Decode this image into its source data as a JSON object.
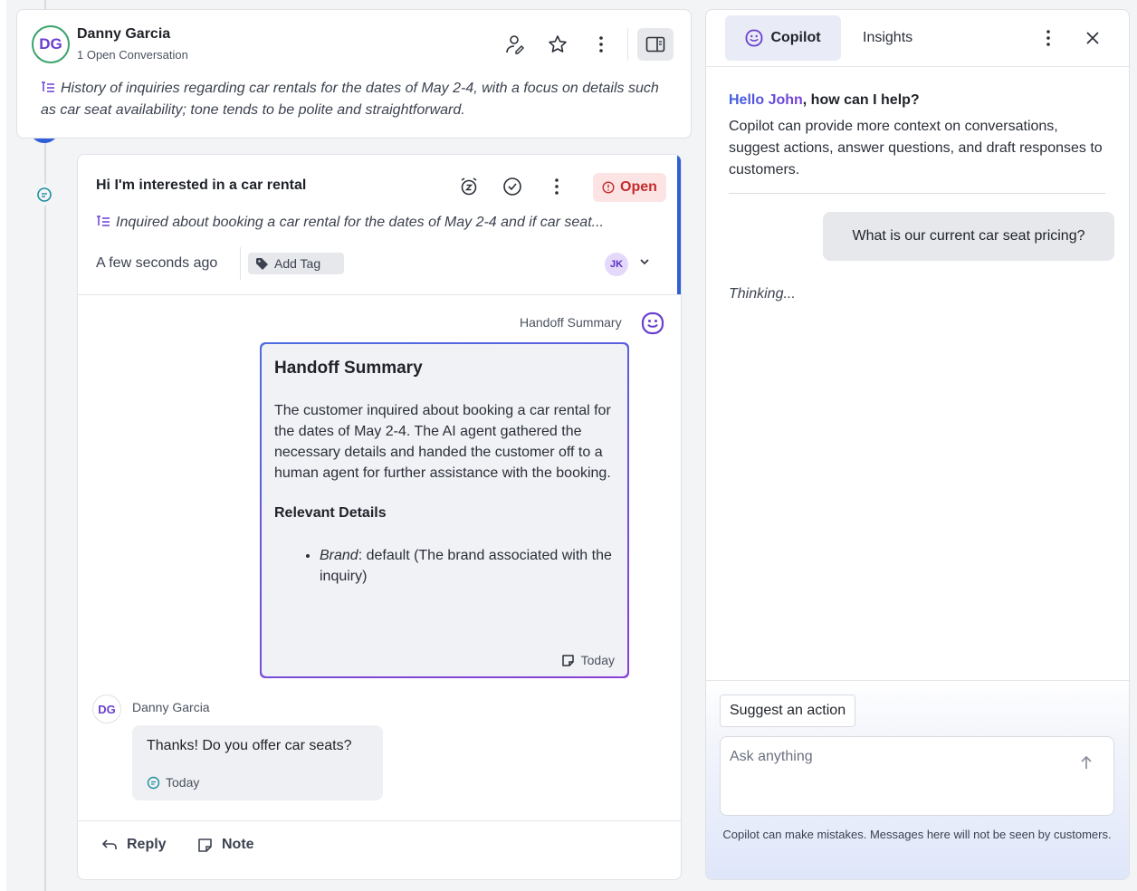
{
  "contact": {
    "initials": "DG",
    "name": "Danny Garcia",
    "subtitle": "1 Open Conversation",
    "summary": "History of inquiries regarding car rentals for the dates of May 2-4, with a focus on details such as car seat availability; tone tends to be polite and straightforward."
  },
  "conversation": {
    "title": "Hi I'm interested in a car rental",
    "status": "Open",
    "summary": "Inquired about booking a car rental for the dates of May 2-4 and if car seat...",
    "time": "A few seconds ago",
    "add_tag_label": "Add Tag",
    "assignee_initials": "JK",
    "status_color": "#c42b2b"
  },
  "handoff": {
    "label": "Handoff Summary",
    "title": "Handoff Summary",
    "body": "The customer inquired about booking a car rental for the dates of May 2-4. The AI agent gathered the necessary details and handed the customer off to a human agent for further assistance with the booking.",
    "details_title": "Relevant Details",
    "detail_key": "Brand",
    "detail_value": ": default (The brand associated with the inquiry)",
    "date": "Today"
  },
  "message": {
    "author_initials": "DG",
    "author": "Danny Garcia",
    "text": "Thanks! Do you offer car seats?",
    "date": "Today"
  },
  "composer": {
    "reply_label": "Reply",
    "note_label": "Note"
  },
  "copilot": {
    "tabs": [
      {
        "label": "Copilot",
        "active": true
      },
      {
        "label": "Insights",
        "active": false
      }
    ],
    "greeting_name": "Hello John",
    "greeting_rest": ", how can I help?",
    "intro": "Copilot can provide more context on conversations, suggest actions, answer questions, and draft responses to customers.",
    "user_question": "What is our current car seat pricing?",
    "thinking": "Thinking...",
    "suggest_label": "Suggest an action",
    "ask_placeholder": "Ask anything",
    "disclaimer": "Copilot can make mistakes. Messages here will not be seen by customers."
  },
  "colors": {
    "accent_blue": "#2f5fd6",
    "brand_purple": "#6a3fd0",
    "open_badge_bg": "#fde4e4"
  },
  "icons": [
    "assign-icon",
    "star-icon",
    "more-icon",
    "panel-toggle-icon",
    "snooze-icon",
    "check-circle-icon",
    "tag-icon",
    "chevron-down-icon",
    "copilot-icon",
    "note-icon",
    "chat-icon",
    "reply-icon",
    "close-icon",
    "send-icon",
    "list-summary-icon"
  ]
}
